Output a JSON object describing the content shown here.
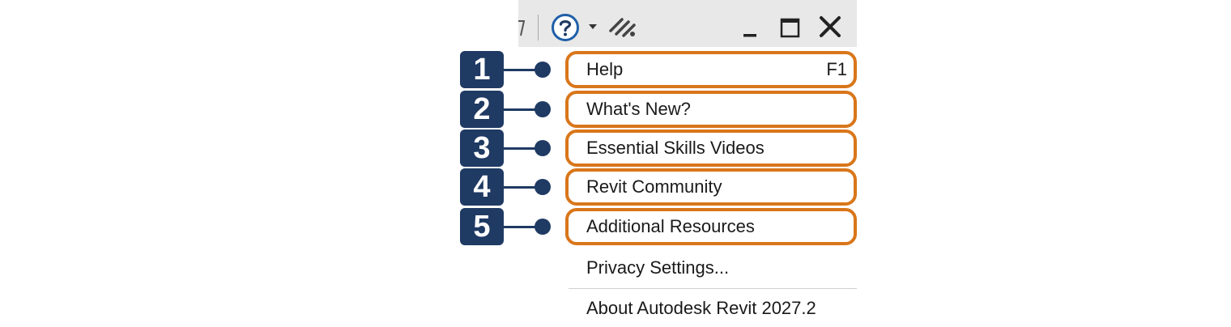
{
  "menu": {
    "items": [
      {
        "label": "Help",
        "shortcut": "F1"
      },
      {
        "label": "What's New?"
      },
      {
        "label": "Essential Skills Videos"
      },
      {
        "label": "Revit Community"
      },
      {
        "label": "Additional Resources"
      },
      {
        "label": "Privacy Settings..."
      },
      {
        "label": "About Autodesk Revit 2027.2"
      }
    ]
  },
  "callouts": [
    "1",
    "2",
    "3",
    "4",
    "5"
  ],
  "titlebar": {
    "icons": [
      "help-icon",
      "dropdown-arrow-icon",
      "community-icon",
      "minimize-icon",
      "maximize-icon",
      "close-icon"
    ]
  },
  "colors": {
    "highlight_border": "#d9761a",
    "callout": "#1f3a63",
    "titlebar_bg": "#e8e8e8",
    "help_icon_blue": "#1f5fa8"
  }
}
